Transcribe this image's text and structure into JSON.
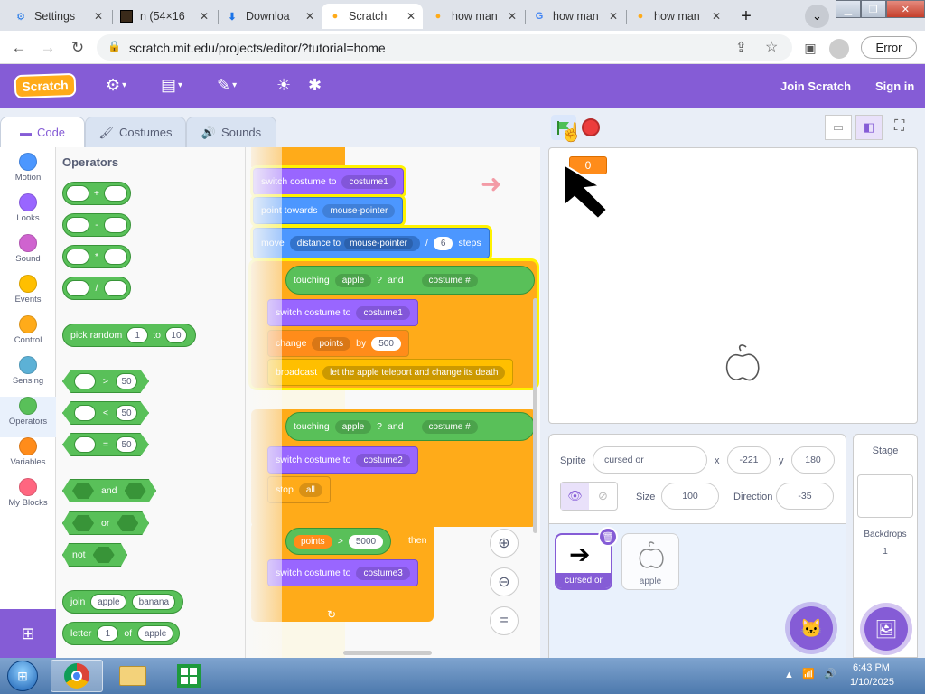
{
  "browser": {
    "tabs": [
      {
        "title": "Settings",
        "icon": "gear-icon"
      },
      {
        "title": "n (54×16",
        "icon": "image-icon"
      },
      {
        "title": "Downloa",
        "icon": "download-icon"
      },
      {
        "title": "Scratch",
        "icon": "scratch-cat-icon",
        "active": true
      },
      {
        "title": "how man",
        "icon": "scratch-cat-icon"
      },
      {
        "title": "how man",
        "icon": "google-icon"
      },
      {
        "title": "how man",
        "icon": "scratch-cat-icon"
      }
    ],
    "url": "scratch.mit.edu/projects/editor/?tutorial=home",
    "error_label": "Error"
  },
  "menubar": {
    "logo": "Scratch",
    "join": "Join Scratch",
    "signin": "Sign in"
  },
  "editor_tabs": {
    "code": "Code",
    "costumes": "Costumes",
    "sounds": "Sounds"
  },
  "categories": [
    {
      "label": "Motion",
      "color": "#4c97ff"
    },
    {
      "label": "Looks",
      "color": "#9966ff"
    },
    {
      "label": "Sound",
      "color": "#cf63cf"
    },
    {
      "label": "Events",
      "color": "#ffbf00"
    },
    {
      "label": "Control",
      "color": "#ffab19"
    },
    {
      "label": "Sensing",
      "color": "#5cb1d6"
    },
    {
      "label": "Operators",
      "color": "#59c059"
    },
    {
      "label": "Variables",
      "color": "#ff8c1a"
    },
    {
      "label": "My Blocks",
      "color": "#ff6680"
    }
  ],
  "palette": {
    "heading": "Operators",
    "arith": [
      "+",
      "-",
      "*",
      "/"
    ],
    "pick_random": {
      "label": "pick random",
      "from": "1",
      "to_label": "to",
      "to": "10"
    },
    "gt": {
      "op": ">",
      "value": "50"
    },
    "lt": {
      "op": "<",
      "value": "50"
    },
    "eq": {
      "op": "=",
      "value": "50"
    },
    "and": "and",
    "or": "or",
    "not": "not",
    "join": {
      "label": "join",
      "a": "apple",
      "b": "banana"
    },
    "letter": {
      "label": "letter",
      "n": "1",
      "of": "of",
      "word": "apple"
    }
  },
  "script": {
    "b1": {
      "verb": "switch costume to",
      "arg": "costume1"
    },
    "b2": {
      "verb": "point towards",
      "arg": "mouse-pointer"
    },
    "b3": {
      "verb": "move",
      "inner": "distance to",
      "arg": "mouse-pointer",
      "div": "/",
      "num": "6",
      "tail": "steps"
    },
    "b4": {
      "cond": "touching",
      "arg": "apple",
      "q": "?",
      "and": "and",
      "rhs": "costume #"
    },
    "b5": {
      "verb": "switch costume to",
      "arg": "costume1"
    },
    "b6": {
      "verb": "change",
      "arg": "points",
      "by": "by",
      "num": "500"
    },
    "b7": {
      "verb": "broadcast",
      "arg": "let the apple teleport and change its death"
    },
    "b8": {
      "cond": "touching",
      "arg": "apple",
      "q": "?",
      "and": "and",
      "rhs": "costume #"
    },
    "b9": {
      "verb": "switch costume to",
      "arg": "costume2"
    },
    "b10": {
      "verb": "stop",
      "arg": "all"
    },
    "b11": {
      "lhs": "points",
      "op": ">",
      "num": "5000",
      "then": "then"
    },
    "b12": {
      "verb": "switch costume to",
      "arg": "costume3"
    }
  },
  "stage": {
    "monitor_value": "0"
  },
  "sprite_info": {
    "sprite_label": "Sprite",
    "sprite_name": "cursed or",
    "x_label": "x",
    "x": "-221",
    "y_label": "y",
    "y": "180",
    "show_label": "Show",
    "size_label": "Size",
    "size": "100",
    "direction_label": "Direction",
    "direction": "-35"
  },
  "sprites": [
    {
      "name": "cursed or",
      "selected": true
    },
    {
      "name": "apple",
      "selected": false
    }
  ],
  "stage_pane": {
    "title": "Stage",
    "backdrops_label": "Backdrops",
    "backdrops_count": "1"
  },
  "taskbar": {
    "time": "6:43 PM",
    "date": "1/10/2025"
  }
}
